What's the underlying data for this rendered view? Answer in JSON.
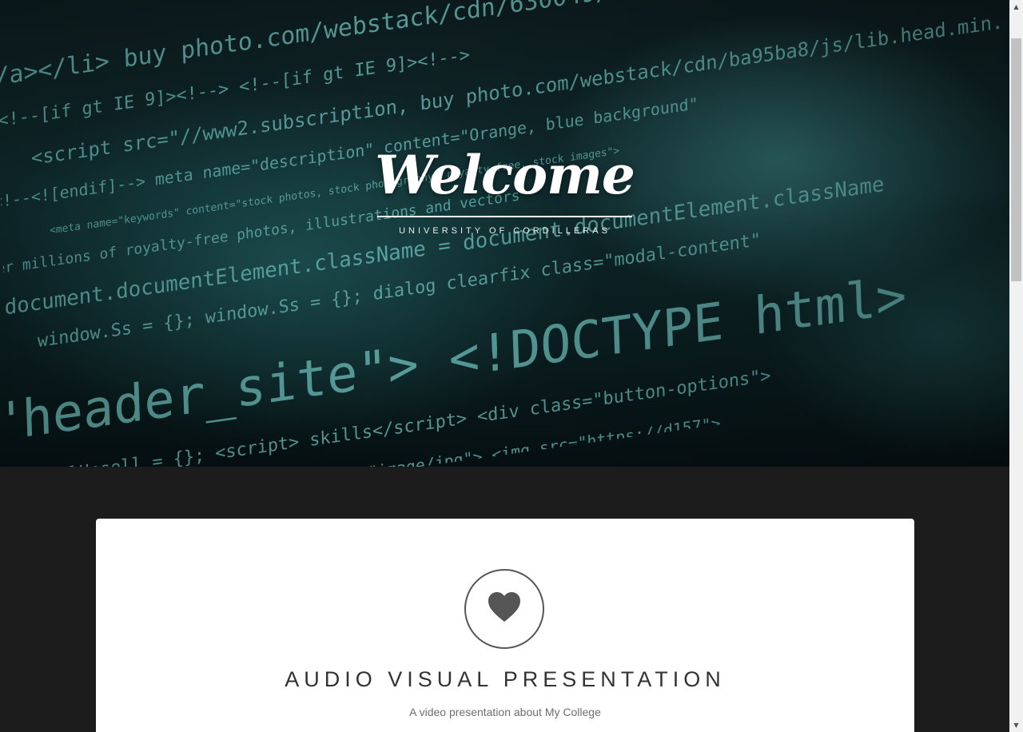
{
  "hero": {
    "title": "Welcome",
    "subtitle": "UNIVERSITY OF CORDILLERAS"
  },
  "feature": {
    "icon": "heart-icon",
    "heading": "AUDIO VISUAL PRESENTATION",
    "description": "A video presentation about My College"
  },
  "colors": {
    "hero_tint": "#2b7f7c",
    "page_background": "#1c1c1c",
    "card_background": "#ffffff",
    "icon_color": "#555555"
  }
}
